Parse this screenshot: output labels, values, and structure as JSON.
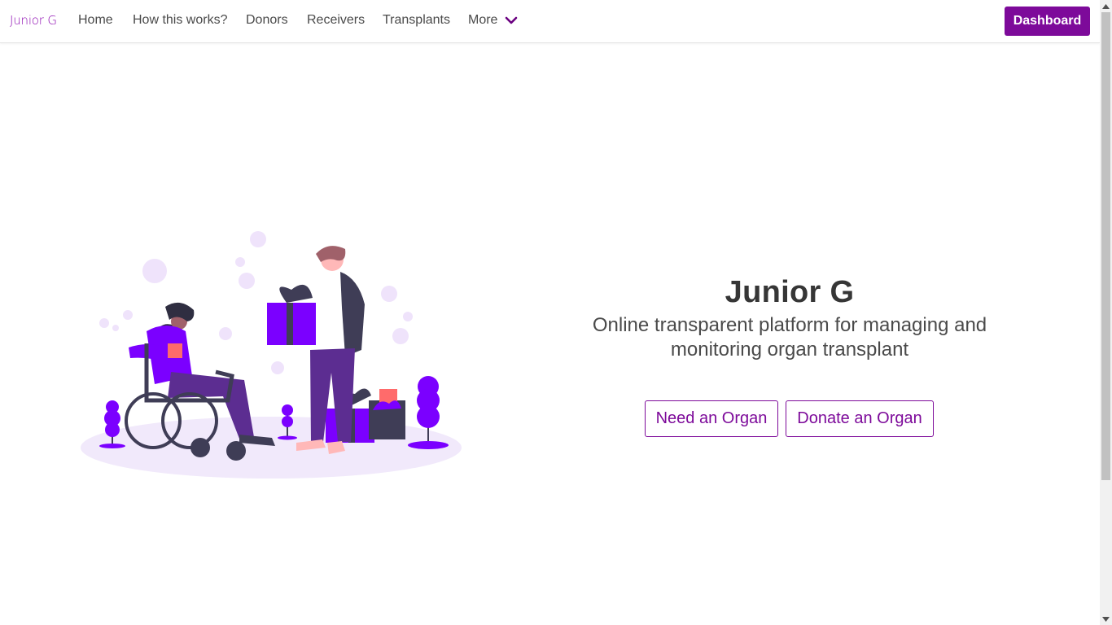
{
  "nav": {
    "brand": "Junior G",
    "items": [
      {
        "label": "Home"
      },
      {
        "label": "How this works?"
      },
      {
        "label": "Donors"
      },
      {
        "label": "Receivers"
      },
      {
        "label": "Transplants"
      }
    ],
    "more_label": "More",
    "dashboard_label": "Dashboard"
  },
  "hero": {
    "title": "Junior G",
    "subtitle_line1": "Online transparent platform for managing and",
    "subtitle_line2": "monitoring organ transplant",
    "need_organ_label": "Need an Organ",
    "donate_organ_label": "Donate an Organ"
  },
  "colors": {
    "primary": "#7d0a9a",
    "accent_purple": "#7b00ff",
    "illustration_light": "#f1e9fb"
  },
  "icons": {
    "more_dropdown": "chevron-down-icon",
    "scroll_up": "arrow-up-icon",
    "scroll_down": "arrow-down-icon"
  }
}
